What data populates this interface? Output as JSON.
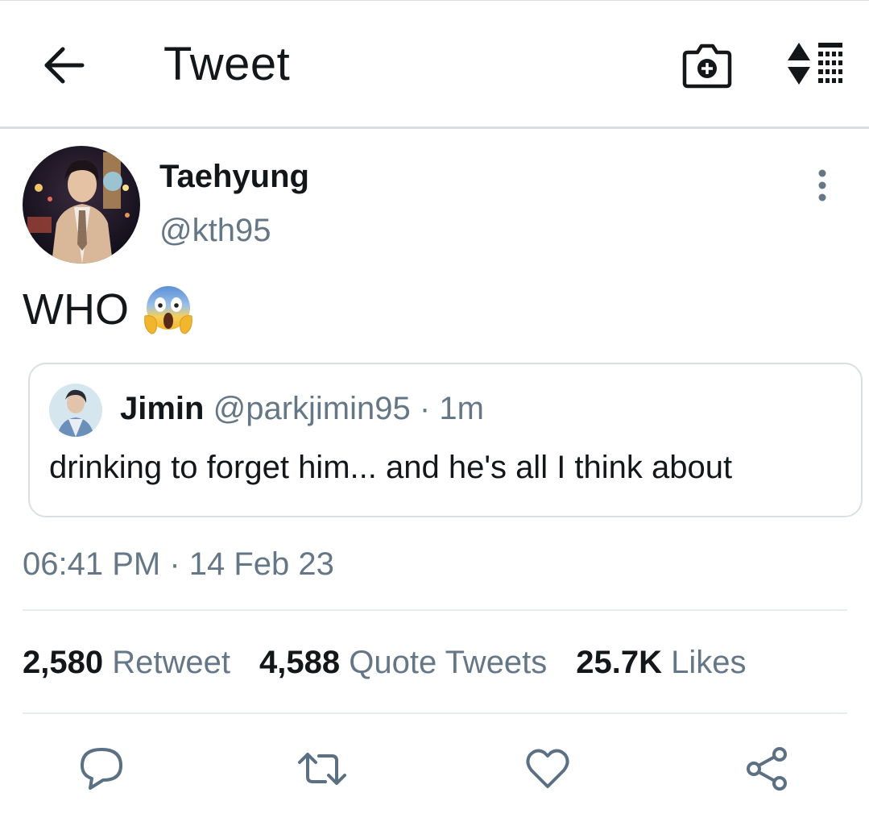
{
  "header": {
    "title": "Tweet",
    "back_icon": "arrow-left-icon",
    "camera_icon": "camera-plus-icon",
    "sort_icon": "sort-list-icon"
  },
  "tweet": {
    "author": {
      "name": "Taehyung",
      "handle": "@kth95"
    },
    "text": "WHO",
    "emoji": "face-screaming-in-fear",
    "quote": {
      "name": "Jimin",
      "handle": "@parkjimin95",
      "separator": "·",
      "time": "1m",
      "text": "drinking to forget him... and he's all I think about"
    },
    "timestamp": "06:41 PM · 14 Feb 23"
  },
  "stats": {
    "retweets": {
      "count": "2,580",
      "label": "Retweet"
    },
    "quotes": {
      "count": "4,588",
      "label": "Quote Tweets"
    },
    "likes": {
      "count": "25.7K",
      "label": "Likes"
    }
  },
  "actions": [
    "reply-icon",
    "retweet-icon",
    "like-icon",
    "share-icon"
  ],
  "colors": {
    "text": "#14171a",
    "secondary": "#657786",
    "border": "#dadfe3",
    "icon": "#5b7083"
  }
}
